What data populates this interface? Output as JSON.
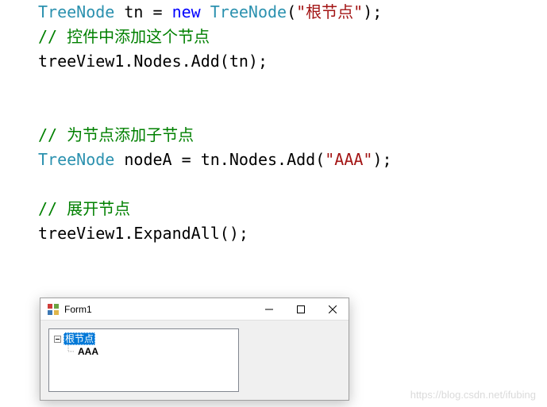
{
  "code": {
    "line1_type": "TreeNode",
    "line1_var": " tn = ",
    "line1_new": "new",
    "line1_ctor": " TreeNode",
    "line1_paren_open": "(",
    "line1_str": "\"根节点\"",
    "line1_paren_close": ");",
    "line2_comment": "// 控件中添加这个节点",
    "line3": "treeView1.Nodes.Add(tn);",
    "line5_comment": "// 为节点添加子节点",
    "line6_type": "TreeNode",
    "line6_rest_a": " nodeA = tn.Nodes.Add(",
    "line6_str": "\"AAA\"",
    "line6_rest_b": ");",
    "line8_comment": "// 展开节点",
    "line9": "treeView1.ExpandAll();"
  },
  "form": {
    "title": "Form1",
    "tree": {
      "root": "根节点",
      "child": "AAA"
    }
  },
  "watermark": "https://blog.csdn.net/ifubing"
}
